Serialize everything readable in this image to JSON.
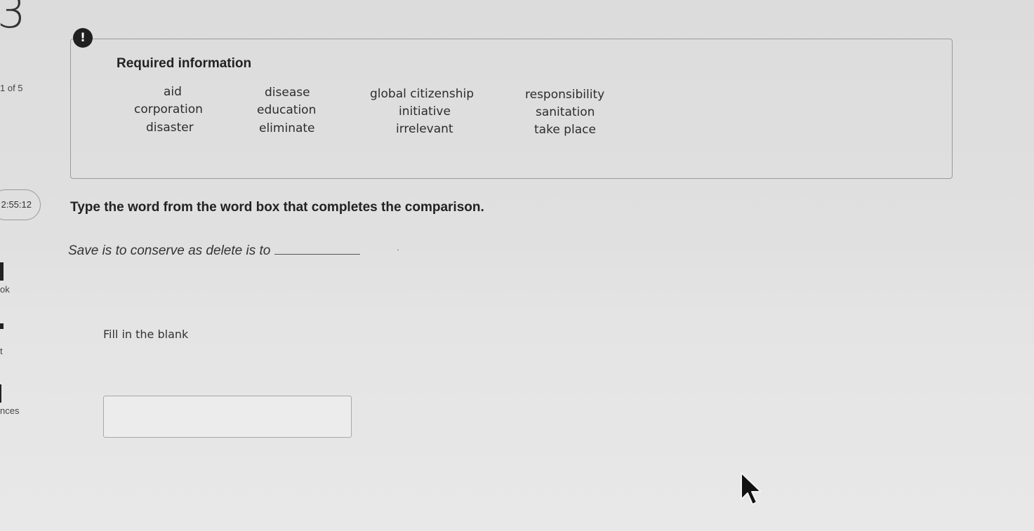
{
  "question": {
    "number": "3",
    "progress": "1 of 5",
    "timer": "2:55:12"
  },
  "info": {
    "alert_symbol": "!",
    "title": "Required information",
    "word_box": [
      "aid",
      "disease",
      "global citizenship",
      "responsibility",
      "corporation",
      "education",
      "initiative",
      "sanitation",
      "disaster",
      "eliminate",
      "irrelevant",
      "take place"
    ]
  },
  "main": {
    "instruction": "Type the word from the word box that completes the comparison.",
    "prompt": "Save is to conserve as delete is to",
    "prompt_end": ".",
    "response_label": "Fill in the blank",
    "answer_value": ""
  },
  "left_nav": {
    "item1": "ok",
    "item2": "t",
    "item3": "nces"
  },
  "icons": {
    "alert": "alert-icon",
    "cursor": "mouse-cursor-icon"
  }
}
